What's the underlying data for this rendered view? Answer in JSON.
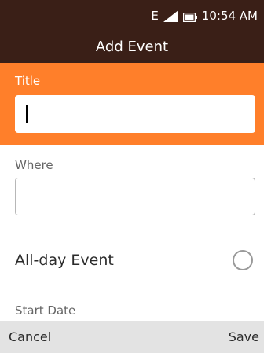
{
  "status_bar": {
    "network_type": "E",
    "signal_icon": "signal-icon",
    "battery_icon": "battery-icon",
    "time": "10:54 AM"
  },
  "header": {
    "title": "Add Event"
  },
  "form": {
    "title_label": "Title",
    "title_value": "",
    "where_label": "Where",
    "where_value": "",
    "allday_label": "All-day Event",
    "allday_checked": false,
    "start_date_label": "Start Date"
  },
  "softkeys": {
    "left": "Cancel",
    "right": "Save"
  },
  "colors": {
    "header_bg": "#3a1f17",
    "accent": "#ff7f2a",
    "softkey_bg": "#e3e3e3"
  }
}
